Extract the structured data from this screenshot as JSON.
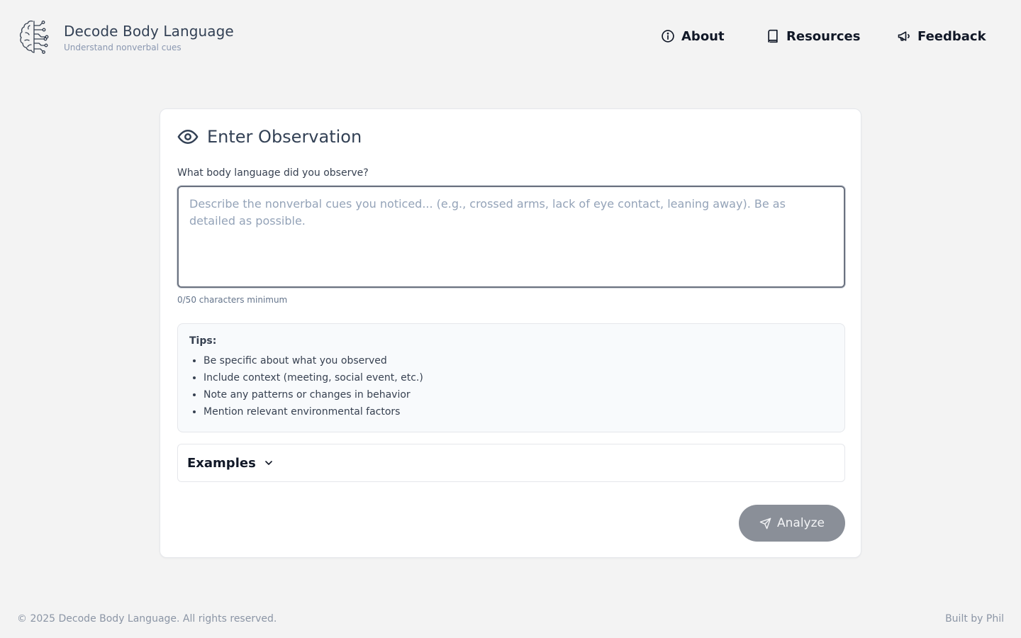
{
  "app": {
    "title": "Decode Body Language",
    "subtitle": "Understand nonverbal cues",
    "logo_icon": "brain-circuit-icon"
  },
  "nav": {
    "items": [
      {
        "label": "About",
        "icon": "info-circle-icon"
      },
      {
        "label": "Resources",
        "icon": "book-icon"
      },
      {
        "label": "Feedback",
        "icon": "megaphone-icon"
      }
    ]
  },
  "form": {
    "title": "Enter Observation",
    "title_icon": "eye-icon",
    "field_label": "What body language did you observe?",
    "textarea": {
      "value": "",
      "placeholder": "Describe the nonverbal cues you noticed... (e.g., crossed arms, lack of eye contact, leaning away). Be as detailed as possible."
    },
    "char_count": "0/50 characters minimum",
    "tips": {
      "title": "Tips:",
      "items": [
        "Be specific about what you observed",
        "Include context (meeting, social event, etc.)",
        "Note any patterns or changes in behavior",
        "Mention relevant environmental factors"
      ]
    },
    "examples": {
      "label": "Examples",
      "icon": "chevron-down-icon"
    },
    "analyze_button": {
      "label": "Analyze",
      "icon": "send-icon",
      "color": "#8a8f98"
    }
  },
  "footer": {
    "copyright": "© 2025 Decode Body Language. All rights reserved.",
    "credit": "Built by Phil"
  }
}
